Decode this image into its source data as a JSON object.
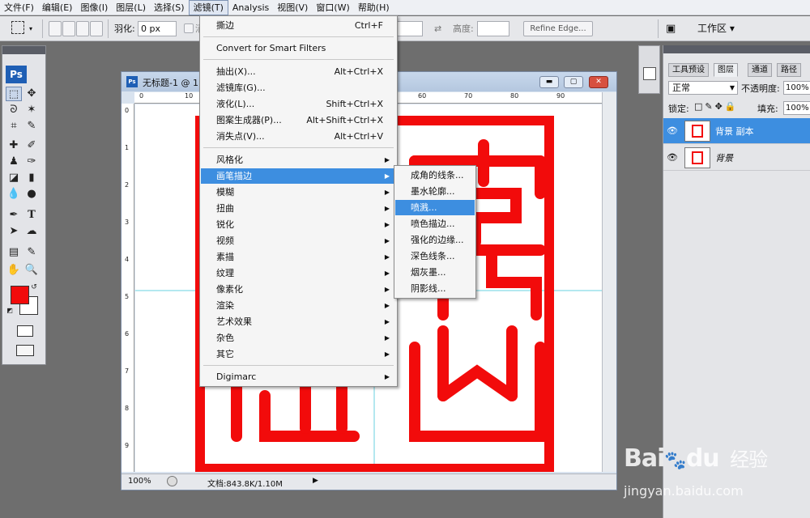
{
  "menubar": {
    "items": [
      "文件(F)",
      "编辑(E)",
      "图像(I)",
      "图层(L)",
      "选择(S)",
      "滤镜(T)",
      "Analysis",
      "视图(V)",
      "窗口(W)",
      "帮助(H)"
    ]
  },
  "options": {
    "feather_label": "羽化:",
    "feather_value": "0 px",
    "antialias_label": "消",
    "height_label": "高度:",
    "refine_edge": "Refine Edge...",
    "workspace": "工作区 ▾"
  },
  "toolbox": {
    "logo": "Ps"
  },
  "document": {
    "title": "无标题-1 @ 1",
    "hruler": [
      "0",
      "10",
      "60",
      "70",
      "80",
      "90"
    ],
    "vruler": [
      "0",
      "1",
      "2",
      "3",
      "4",
      "5",
      "6",
      "7",
      "8",
      "9"
    ],
    "zoom": "100%",
    "doc_info": "文档:843.8K/1.10M"
  },
  "filter_menu": {
    "last_filter": {
      "label": "撕边",
      "shortcut": "Ctrl+F"
    },
    "convert": "Convert for Smart Filters",
    "group1": [
      {
        "label": "抽出(X)...",
        "shortcut": "Alt+Ctrl+X"
      },
      {
        "label": "滤镜库(G)...",
        "shortcut": ""
      },
      {
        "label": "液化(L)...",
        "shortcut": "Shift+Ctrl+X"
      },
      {
        "label": "图案生成器(P)...",
        "shortcut": "Alt+Shift+Ctrl+X"
      },
      {
        "label": "消失点(V)...",
        "shortcut": "Alt+Ctrl+V"
      }
    ],
    "group2": [
      "风格化",
      "画笔描边",
      "模糊",
      "扭曲",
      "锐化",
      "视频",
      "素描",
      "纹理",
      "像素化",
      "渲染",
      "艺术效果",
      "杂色",
      "其它"
    ],
    "highlighted_index": 1,
    "digimarc": "Digimarc"
  },
  "brush_submenu": {
    "items": [
      "成角的线条...",
      "墨水轮廓...",
      "喷溅...",
      "喷色描边...",
      "强化的边缘...",
      "深色线条...",
      "烟灰墨...",
      "阴影线..."
    ],
    "highlighted_index": 2
  },
  "layers_panel": {
    "tabs": [
      "工具预设",
      "图层",
      "通道",
      "路径"
    ],
    "blend_mode": "正常",
    "opacity_label": "不透明度:",
    "opacity_value": "100%",
    "lock_label": "锁定:",
    "fill_label": "填充:",
    "fill_value": "100%",
    "layers": [
      "背景 副本",
      "背景"
    ],
    "selected_index": 0
  },
  "watermark": {
    "brand": "Bai",
    "brand2": "du",
    "cn": "经验",
    "url": "jingyan.baidu.com"
  },
  "colors": {
    "foreground": "#f20b0b",
    "seal_red": "#f20b0b",
    "menu_highlight": "#3d8ee0"
  }
}
